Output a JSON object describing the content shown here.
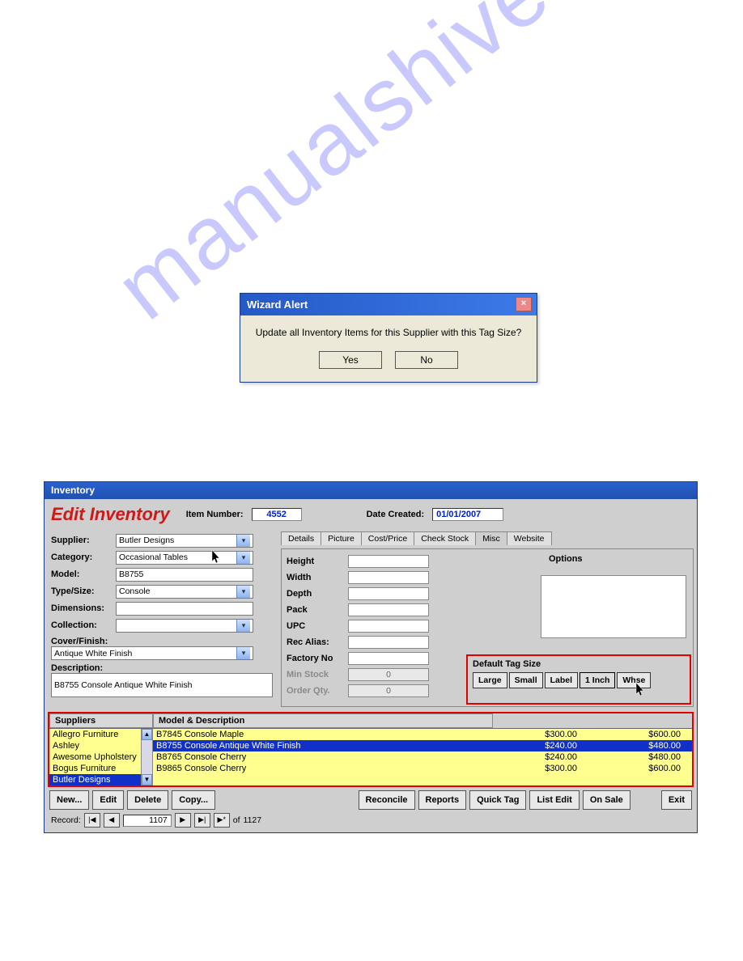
{
  "alert": {
    "title": "Wizard Alert",
    "message": "Update all Inventory Items for this Supplier with this Tag Size?",
    "yes": "Yes",
    "no": "No"
  },
  "inv": {
    "window_title": "Inventory",
    "page_title": "Edit Inventory",
    "item_number_label": "Item Number:",
    "item_number": "4552",
    "date_created_label": "Date Created:",
    "date_created": "01/01/2007",
    "form": {
      "supplier_label": "Supplier:",
      "supplier": "Butler Designs",
      "category_label": "Category:",
      "category": "Occasional Tables",
      "model_label": "Model:",
      "model": "B8755",
      "typesize_label": "Type/Size:",
      "typesize": "Console",
      "dimensions_label": "Dimensions:",
      "dimensions": "",
      "collection_label": "Collection:",
      "collection": "",
      "cover_label": "Cover/Finish:",
      "cover": "Antique White Finish",
      "desc_label": "Description:",
      "desc": "B8755 Console Antique White Finish"
    },
    "tabs": [
      "Details",
      "Picture",
      "Cost/Price",
      "Check Stock",
      "Misc",
      "Website"
    ],
    "active_tab": 4,
    "misc": {
      "height_label": "Height",
      "width_label": "Width",
      "depth_label": "Depth",
      "pack_label": "Pack",
      "upc_label": "UPC",
      "rec_alias_label": "Rec Alias:",
      "factory_no_label": "Factory No",
      "min_stock_label": "Min Stock",
      "min_stock": "0",
      "order_qty_label": "Order Qty.",
      "order_qty": "0",
      "options_label": "Options",
      "tag_label": "Default Tag Size",
      "tag_buttons": [
        "Large",
        "Small",
        "Label",
        "1 Inch",
        "Whse"
      ]
    },
    "grid": {
      "col_suppliers": "Suppliers",
      "col_model": "Model & Description",
      "suppliers": [
        "Allegro Furniture",
        "Ashley",
        "Awesome Upholstery",
        "Bogus Furniture",
        "Butler Designs"
      ],
      "selected_supplier": 4,
      "rows": [
        {
          "desc": "B7845 Console Maple",
          "p1": "$300.00",
          "p2": "$600.00"
        },
        {
          "desc": "B8755 Console Antique White Finish",
          "p1": "$240.00",
          "p2": "$480.00"
        },
        {
          "desc": "B8765 Console Cherry",
          "p1": "$240.00",
          "p2": "$480.00"
        },
        {
          "desc": "B9865 Console Cherry",
          "p1": "$300.00",
          "p2": "$600.00"
        }
      ],
      "selected_row": 1
    },
    "buttons": {
      "new": "New...",
      "edit": "Edit",
      "delete": "Delete",
      "copy": "Copy...",
      "reconcile": "Reconcile",
      "reports": "Reports",
      "quicktag": "Quick Tag",
      "listedit": "List Edit",
      "onsale": "On Sale",
      "exit": "Exit"
    },
    "nav": {
      "label": "Record:",
      "pos": "1107",
      "of": "of",
      "total": "1127"
    }
  },
  "watermark": "manualshive.com"
}
